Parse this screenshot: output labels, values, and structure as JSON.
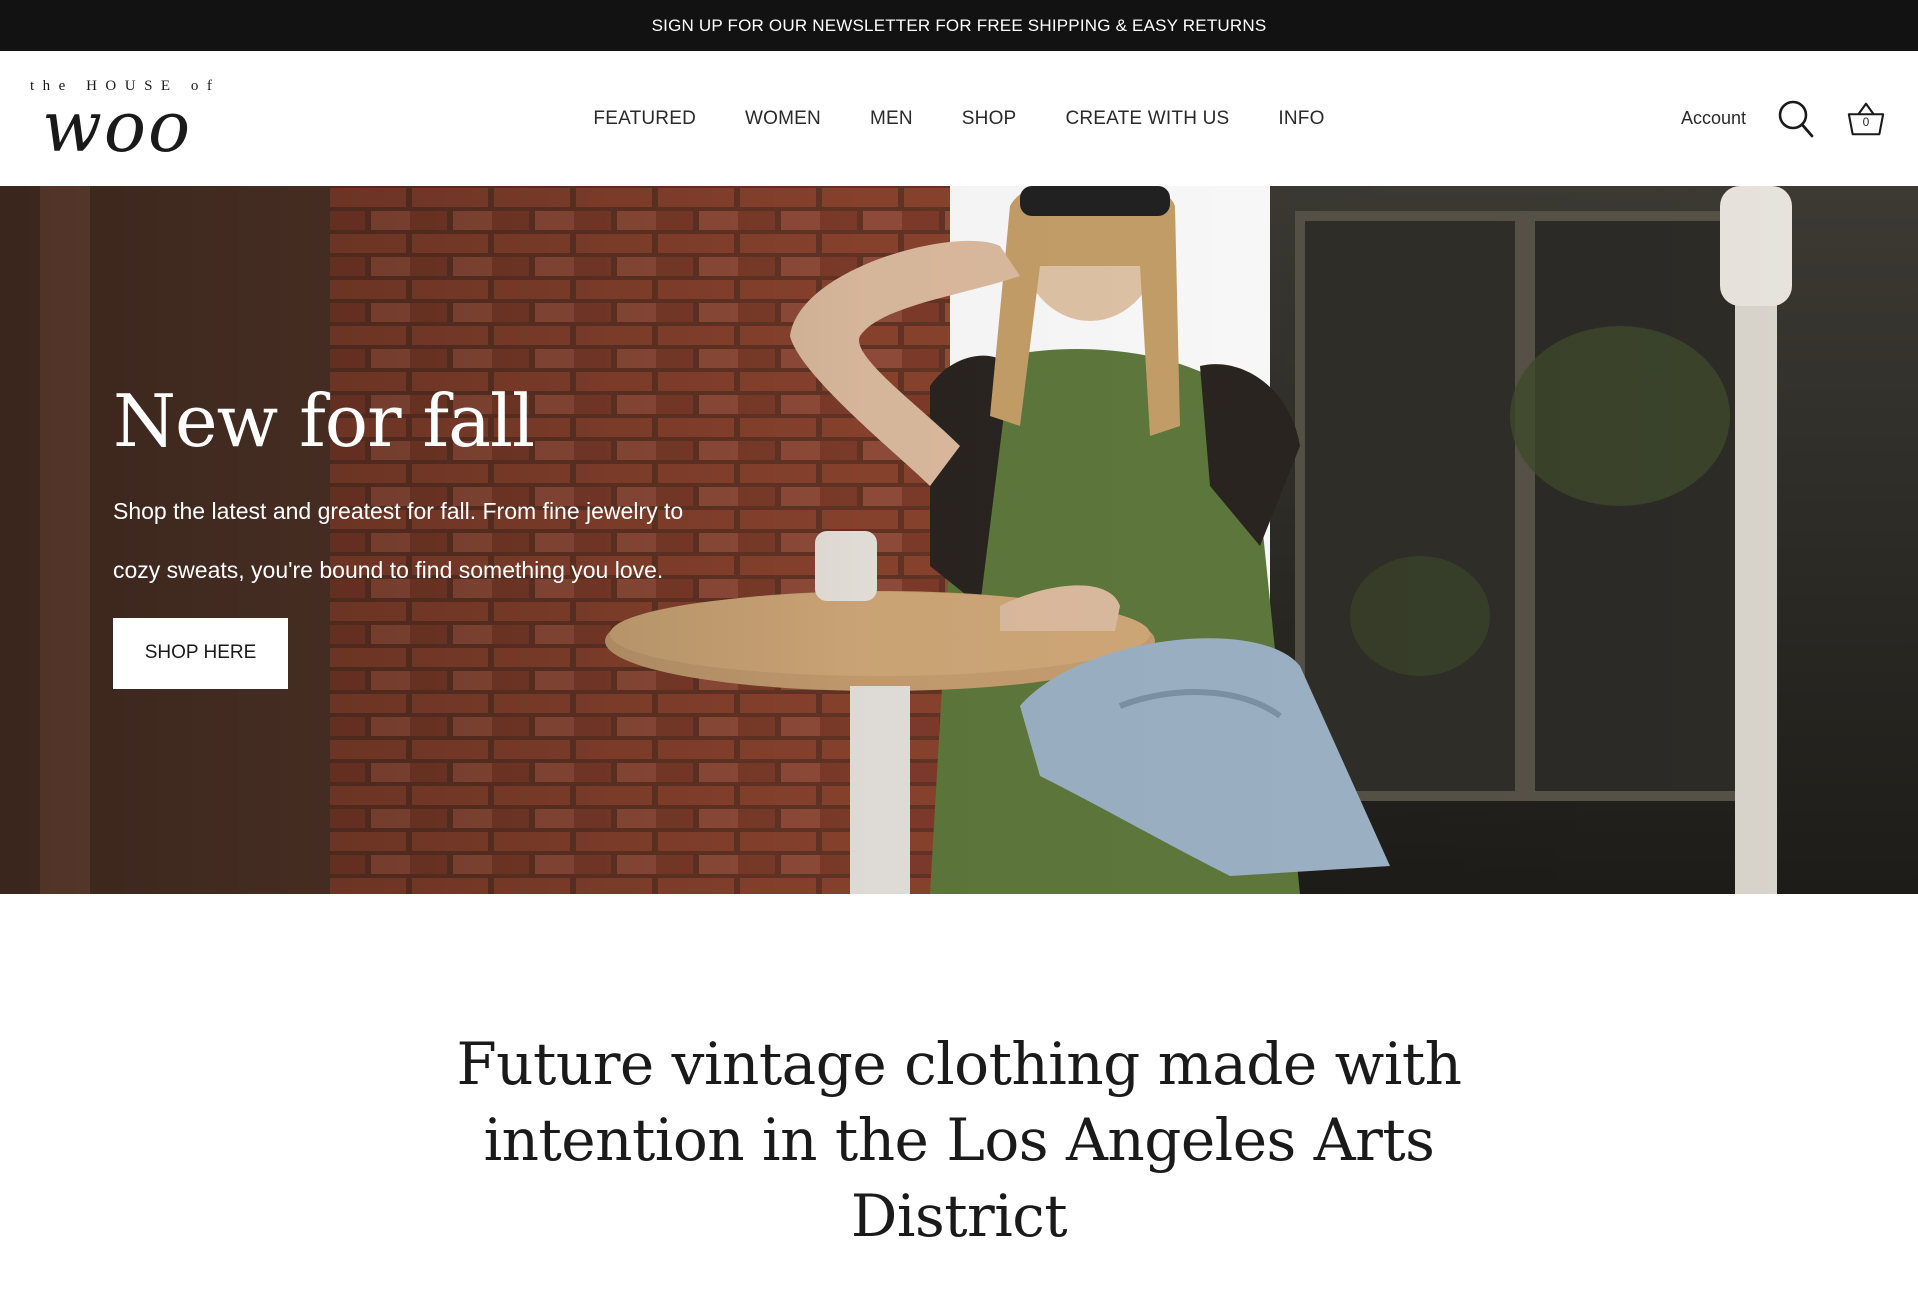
{
  "announcement": "SIGN UP FOR OUR NEWSLETTER FOR FREE SHIPPING & EASY RETURNS",
  "logo": {
    "top": "the HOUSE of",
    "main": "woo"
  },
  "nav": [
    {
      "label": "FEATURED"
    },
    {
      "label": "WOMEN"
    },
    {
      "label": "MEN"
    },
    {
      "label": "SHOP"
    },
    {
      "label": "CREATE WITH US"
    },
    {
      "label": "INFO"
    }
  ],
  "header": {
    "account_label": "Account",
    "search_icon": "search-icon",
    "cart_icon": "basket-icon",
    "cart_count": "0"
  },
  "hero": {
    "title": "New for fall",
    "text": "Shop the latest and greatest for fall. From fine jewelry to cozy sweats, you're bound to find something you love.",
    "button_label": "SHOP HERE"
  },
  "intro": {
    "heading": "Future vintage clothing made with intention in the Los Angeles Arts District"
  },
  "colors": {
    "announcement_bg": "#121212",
    "brick": "#8a4a33",
    "dress": "#5f7a3d",
    "denim": "#9fb4c8"
  }
}
